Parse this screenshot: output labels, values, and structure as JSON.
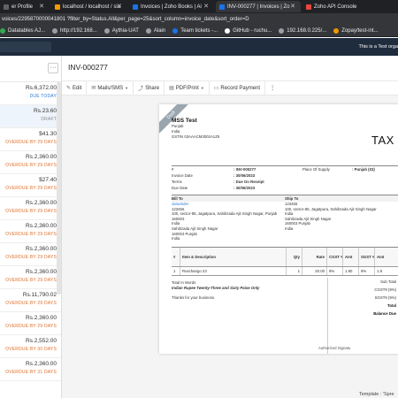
{
  "browser": {
    "tabs": [
      {
        "label": "er Profile",
        "color": "#5f6368",
        "active": false
      },
      {
        "label": "localhost / localhost / sia",
        "color": "#f29900",
        "active": false
      },
      {
        "label": "Invoices | Zoho Books | Ai",
        "color": "#1a73e8",
        "active": false
      },
      {
        "label": "INV-000277 | Invoices | Zo",
        "color": "#1a73e8",
        "active": true
      },
      {
        "label": "Zoho API Console",
        "color": "#e8453c",
        "active": false
      }
    ],
    "url": "voices/2295870000041801 ?filter_by=Status.All&per_page=25&sort_column=invoice_date&sort_order=D",
    "bookmarks": [
      {
        "label": "Datatables AJ...",
        "color": "#34a853"
      },
      {
        "label": "http://192.168...",
        "color": "#9aa0a6"
      },
      {
        "label": "Aythia-UAT",
        "color": "#9aa0a6"
      },
      {
        "label": "Alain",
        "color": "#9aa0a6"
      },
      {
        "label": "Team tickets -...",
        "color": "#1a73e8"
      },
      {
        "label": "GitHub - ruchu...",
        "color": "#ffffff"
      },
      {
        "label": "192.168.0.225/...",
        "color": "#9aa0a6"
      },
      {
        "label": "Zopay/test-int...",
        "color": "#f29900"
      }
    ]
  },
  "banner": {
    "notice": "This is a Test orga"
  },
  "list": {
    "more_label": "···",
    "items": [
      {
        "amount": "Rs.6,372.00",
        "status": "DUE TODAY",
        "kind": "blue",
        "selected": false
      },
      {
        "amount": "Rs.23.60",
        "status": "DRAFT",
        "kind": "draft",
        "selected": true
      },
      {
        "amount": "$41.30",
        "status": "OVERDUE BY 29 DAYS",
        "kind": "overdue",
        "selected": false
      },
      {
        "amount": "Rs.2,360.00",
        "status": "OVERDUE BY 29 DAYS",
        "kind": "overdue",
        "selected": false
      },
      {
        "amount": "$27.40",
        "status": "OVERDUE BY 29 DAYS",
        "kind": "overdue",
        "selected": false
      },
      {
        "amount": "Rs.2,360.00",
        "status": "OVERDUE BY 29 DAYS",
        "kind": "overdue",
        "selected": false
      },
      {
        "amount": "Rs.2,360.00",
        "status": "OVERDUE BY 29 DAYS",
        "kind": "overdue",
        "selected": false
      },
      {
        "amount": "Rs.2,360.00",
        "status": "OVERDUE BY 29 DAYS",
        "kind": "overdue",
        "selected": false
      },
      {
        "amount": "Rs.2,360.00",
        "status": "OVERDUE BY 29 DAYS",
        "kind": "overdue",
        "selected": false
      },
      {
        "amount": "Rs.11,790.02",
        "status": "OVERDUE BY 29 DAYS",
        "kind": "overdue",
        "selected": false
      },
      {
        "amount": "Rs.2,360.00",
        "status": "OVERDUE BY 29 DAYS",
        "kind": "overdue",
        "selected": false
      },
      {
        "amount": "Rs.2,552.00",
        "status": "OVERDUE BY 30 DAYS",
        "kind": "overdue",
        "selected": false
      },
      {
        "amount": "Rs.2,360.00",
        "status": "OVERDUE BY 31 DAYS",
        "kind": "overdue",
        "selected": false
      }
    ]
  },
  "main": {
    "title": "INV-000277",
    "toolbar": {
      "edit": "Edit",
      "mail": "Mails/SMS",
      "share": "Share",
      "pdf": "PDF/Print",
      "record": "Record Payment",
      "more": "⋮"
    },
    "template_label": "Template : 'Spre"
  },
  "invoice": {
    "ribbon": "Draft",
    "company": "MSS Test",
    "company_lines": [
      "Punjab",
      "India",
      "GSTIN 03AAACM3002A1Z5"
    ],
    "doc_title": "TAX INVOICE",
    "meta": {
      "num_label": "#",
      "num_value": ": INV-000277",
      "date_label": "Invoice Date",
      "date_value": ": 30/06/2023",
      "terms_label": "Terms",
      "terms_value": ": Due On Receipt",
      "due_label": "Due Date",
      "due_value": ": 30/06/2023",
      "pos_label": "Place Of Supply",
      "pos_value": ": Punjab (03)"
    },
    "bill_to_label": "Bill To",
    "ship_to_label": "Ship To",
    "bill_to": [
      "Jaswinder",
      "123456",
      "100, sector-85, Jagatpura, Sahibzada Ajit Singh Nagar, Punjab 160003",
      "India",
      "Sahibzada Ajit Singh Nagar",
      "160003 Punjab",
      "India"
    ],
    "ship_to": [
      "123456",
      "100, sector-85, Jagatpura, Sahibzada Ajit Singh Nagar",
      "India",
      "Sahibzada Ajit Singh Nagar",
      "160003 Punjab",
      "India"
    ],
    "table": {
      "headers": [
        "#",
        "Item & Description",
        "Qty",
        "Rate",
        "CGST %",
        "Amt",
        "SGST %",
        "Amt"
      ],
      "row": [
        "1",
        "Ruschango 23",
        "1",
        "20.00",
        "9%",
        "1.80",
        "9%",
        "1.8"
      ]
    },
    "words_label": "Total In Words",
    "words": "Indian Rupee Twenty-Three and Sixty Paise Only",
    "thanks": "Thanks for your business.",
    "totals": {
      "subtotal_label": "Sub Total",
      "cgst": "CGST9 (9%)",
      "sgst": "SGST9 (9%)",
      "total": "Total",
      "balance": "Balance Due"
    },
    "signature": "Authorized Signatu"
  }
}
